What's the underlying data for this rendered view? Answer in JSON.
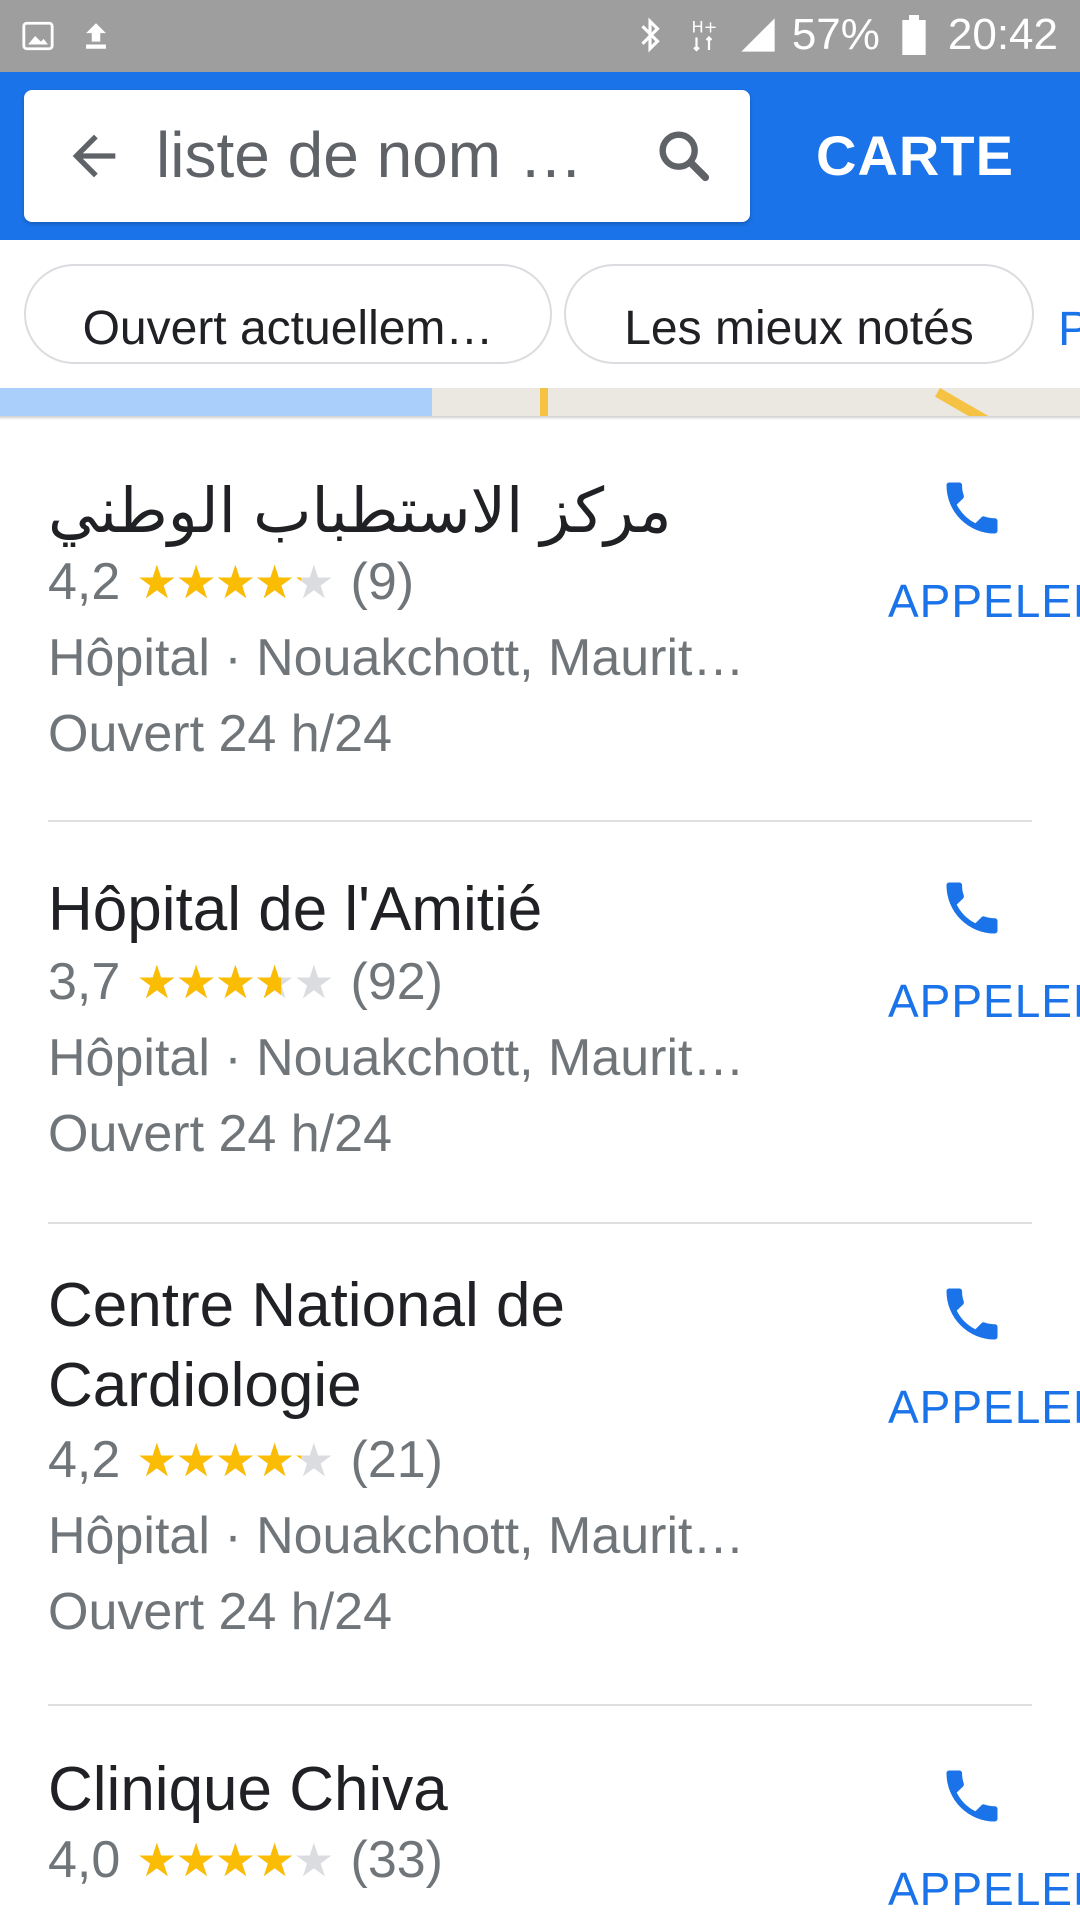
{
  "status_bar": {
    "icons_left": [
      "image-icon",
      "upload-icon"
    ],
    "icons_right": [
      "bluetooth-icon",
      "network-hplus-icon",
      "signal-icon",
      "battery-icon"
    ],
    "battery": "57%",
    "time": "20:42"
  },
  "search": {
    "query": "liste de nom …",
    "map_button": "CARTE"
  },
  "filters": {
    "chip_1": "Ouvert actuellem…",
    "chip_2": "Les mieux notés",
    "chip_3": "P"
  },
  "colors": {
    "accent": "#1a73e8",
    "star": "#fbbc04",
    "status_bar": "#9e9e9e"
  },
  "results": [
    {
      "name": "مركز الاستطباب الوطني",
      "rating": "4,2",
      "rating_fraction": 0.84,
      "reviews": "(9)",
      "category": "Hôpital · Nouakchott, Maurit…",
      "hours": "Ouvert 24 h/24",
      "call_label": "APPELER"
    },
    {
      "name": "Hôpital de l'Amitié",
      "rating": "3,7",
      "rating_fraction": 0.74,
      "reviews": "(92)",
      "category": "Hôpital · Nouakchott, Maurit…",
      "hours": "Ouvert 24 h/24",
      "call_label": "APPELER"
    },
    {
      "name": "Centre National de Cardiologie",
      "rating": "4,2",
      "rating_fraction": 0.84,
      "reviews": "(21)",
      "category": "Hôpital · Nouakchott, Maurit…",
      "hours": "Ouvert 24 h/24",
      "call_label": "APPELER"
    },
    {
      "name": "Clinique Chiva",
      "rating": "4,0",
      "rating_fraction": 0.8,
      "reviews": "(33)",
      "category": "",
      "hours": "",
      "call_label": "APPELER"
    }
  ]
}
